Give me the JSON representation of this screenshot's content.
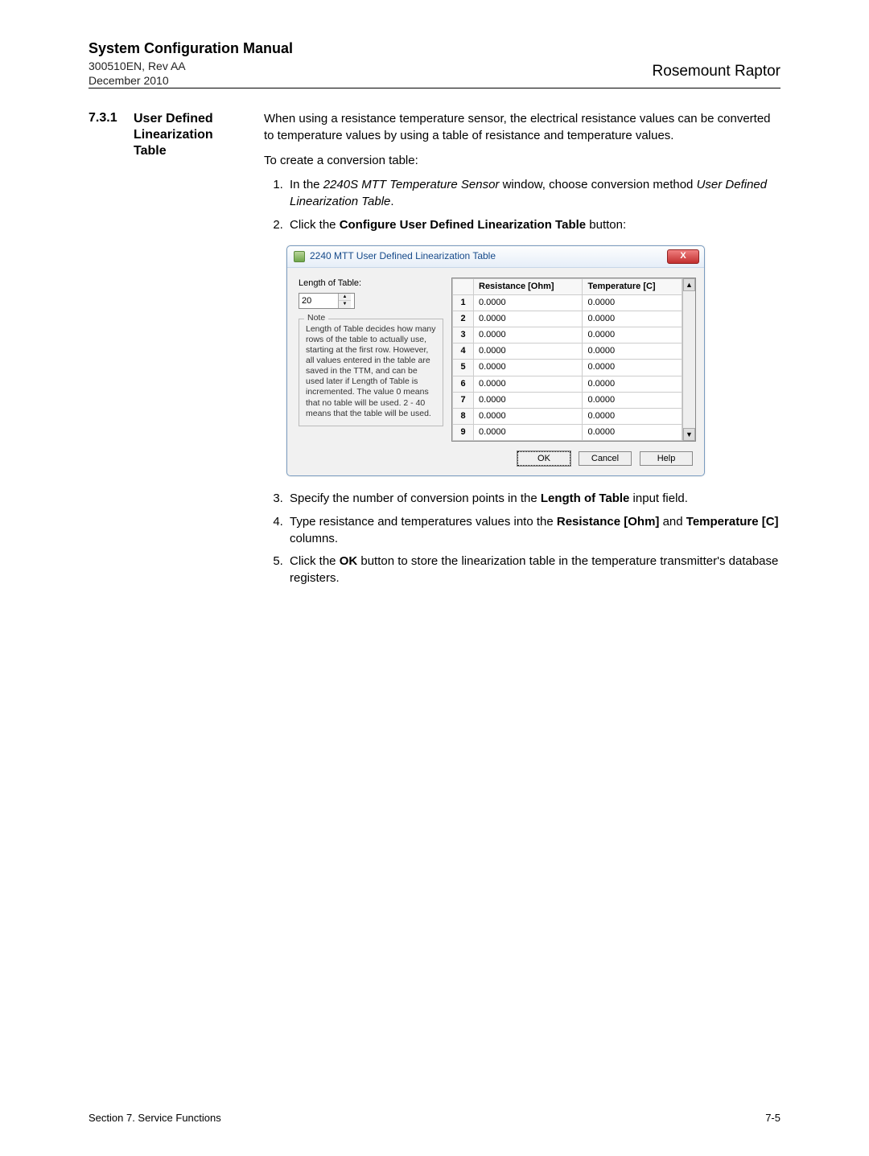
{
  "header": {
    "title": "System Configuration Manual",
    "doc_id": "300510EN, Rev AA",
    "date": "December 2010",
    "brand": "Rosemount Raptor"
  },
  "section": {
    "number": "7.3.1",
    "title_l1": "User Defined",
    "title_l2": "Linearization",
    "title_l3": "Table"
  },
  "body": {
    "para1": "When using a resistance temperature sensor, the electrical resistance values can be converted to temperature values by using a table of resistance and temperature values.",
    "para2": "To create a conversion table:",
    "step1a": "In the ",
    "step1b_italic": "2240S MTT Temperature Sensor",
    "step1c": " window, choose conversion method ",
    "step1d_italic": "User Defined Linearization Table",
    "step1e": ".",
    "step2a": "Click the ",
    "step2b_bold": "Configure User Defined Linearization Table",
    "step2c": " button:",
    "step3a": "Specify the number of conversion points in the ",
    "step3b_bold": "Length of Table",
    "step3c": " input field.",
    "step4a": "Type resistance and temperatures values into the ",
    "step4b_bold": "Resistance [Ohm]",
    "step4c": " and ",
    "step4d_bold": "Temperature [C]",
    "step4e": " columns.",
    "step5a": "Click the ",
    "step5b_bold": "OK",
    "step5c": " button to store the linearization table in the temperature transmitter's database registers."
  },
  "dialog": {
    "title": "2240 MTT User Defined Linearization Table",
    "close_glyph": "X",
    "length_label": "Length of Table:",
    "length_value": "20",
    "note_legend": "Note",
    "note_text": "Length of Table decides how many rows of the table to actually use, starting at the first row. However, all values entered in the table are saved in the TTM, and can be used later if Length of Table is incremented. The value 0 means that no table will be used. 2 - 40 means that the table will be used.",
    "col_index": "",
    "col_res": "Resistance [Ohm]",
    "col_temp": "Temperature [C]",
    "rows": [
      {
        "i": "1",
        "r": "0.0000",
        "t": "0.0000"
      },
      {
        "i": "2",
        "r": "0.0000",
        "t": "0.0000"
      },
      {
        "i": "3",
        "r": "0.0000",
        "t": "0.0000"
      },
      {
        "i": "4",
        "r": "0.0000",
        "t": "0.0000"
      },
      {
        "i": "5",
        "r": "0.0000",
        "t": "0.0000"
      },
      {
        "i": "6",
        "r": "0.0000",
        "t": "0.0000"
      },
      {
        "i": "7",
        "r": "0.0000",
        "t": "0.0000"
      },
      {
        "i": "8",
        "r": "0.0000",
        "t": "0.0000"
      },
      {
        "i": "9",
        "r": "0.0000",
        "t": "0.0000"
      }
    ],
    "btn_ok": "OK",
    "btn_cancel": "Cancel",
    "btn_help": "Help",
    "scroll_up": "▲",
    "scroll_down": "▼",
    "spin_up": "▲",
    "spin_down": "▼"
  },
  "footer": {
    "left": "Section 7. Service Functions",
    "right": "7-5"
  }
}
